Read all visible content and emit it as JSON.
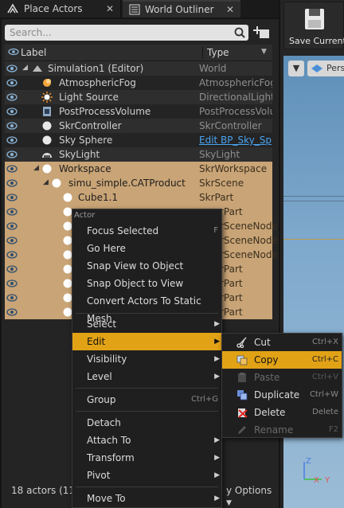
{
  "tabs": [
    {
      "label": "Place Actors"
    },
    {
      "label": "World Outliner"
    }
  ],
  "toolbar": {
    "save_label": "Save Current"
  },
  "viewport": {
    "perspective_label": "Pers"
  },
  "search": {
    "placeholder": "Search..."
  },
  "columns": {
    "label": "Label",
    "type": "Type"
  },
  "rows": [
    {
      "name": "Simulation1 (Editor)",
      "type": "World"
    },
    {
      "name": "AtmosphericFog",
      "type": "AtmosphericFog"
    },
    {
      "name": "Light Source",
      "type": "DirectionalLight"
    },
    {
      "name": "PostProcessVolume",
      "type": "PostProcessVolu"
    },
    {
      "name": "SkrController",
      "type": "SkrController"
    },
    {
      "name": "Sky Sphere",
      "type": "Edit BP_Sky_Sp"
    },
    {
      "name": "SkyLight",
      "type": "SkyLight"
    },
    {
      "name": "Workspace",
      "type": "SkrWorkspace"
    },
    {
      "name": "simu_simple.CATProduct",
      "type": "SkrScene"
    },
    {
      "name": "Cube1.1",
      "type": "SkrPart"
    },
    {
      "name": "",
      "type": "rPart"
    },
    {
      "name": "",
      "type": "rSceneNode"
    },
    {
      "name": "",
      "type": "rSceneNode"
    },
    {
      "name": "",
      "type": "rSceneNode"
    },
    {
      "name": "",
      "type": "rPart"
    },
    {
      "name": "",
      "type": "rPart"
    },
    {
      "name": "",
      "type": "rPart"
    },
    {
      "name": "",
      "type": "rPart"
    }
  ],
  "status": {
    "count": "18 actors (11",
    "view_options": "y Options"
  },
  "context_menu": {
    "header": "Actor",
    "items": [
      {
        "label": "Focus Selected",
        "shortcut": "F"
      },
      {
        "label": "Go Here"
      },
      {
        "label": "Snap View to Object"
      },
      {
        "label": "Snap Object to View"
      },
      {
        "label": "Convert Actors To Static Mesh"
      },
      {
        "label": "Select"
      },
      {
        "label": "Edit"
      },
      {
        "label": "Visibility"
      },
      {
        "label": "Level"
      },
      {
        "label": "Group",
        "shortcut": "Ctrl+G"
      },
      {
        "label": "Detach"
      },
      {
        "label": "Attach To"
      },
      {
        "label": "Transform"
      },
      {
        "label": "Pivot"
      },
      {
        "label": "Move To"
      }
    ]
  },
  "edit_submenu": {
    "items": [
      {
        "label": "Cut",
        "shortcut": "Ctrl+X",
        "icon": "scissors-icon"
      },
      {
        "label": "Copy",
        "shortcut": "Ctrl+C",
        "icon": "copy-icon"
      },
      {
        "label": "Paste",
        "shortcut": "Ctrl+V",
        "icon": "paste-icon"
      },
      {
        "label": "Duplicate",
        "shortcut": "Ctrl+W",
        "icon": "duplicate-icon"
      },
      {
        "label": "Delete",
        "shortcut": "Delete",
        "icon": "delete-icon"
      },
      {
        "label": "Rename",
        "shortcut": "F2",
        "icon": "rename-icon"
      }
    ]
  },
  "colors": {
    "selection": "#c9a476",
    "highlight": "#e2a216",
    "link": "#4aa3f0"
  }
}
